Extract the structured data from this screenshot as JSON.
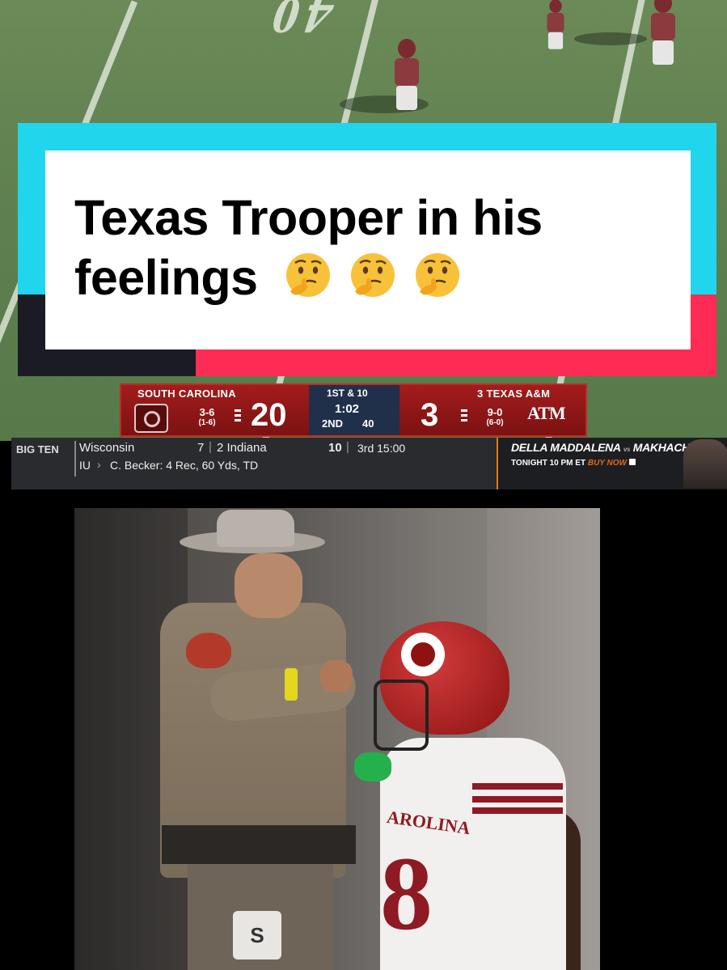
{
  "caption": {
    "line1": "Texas Trooper in his",
    "line2": "feelings",
    "emoji": "🤔🤔🤔",
    "emoji_icons": [
      "thinking-face",
      "thinking-face",
      "thinking-face"
    ]
  },
  "scorebug": {
    "home_team": "SOUTH CAROLINA",
    "home_record": "3-6",
    "home_conf_record": "(1-6)",
    "home_score": "20",
    "down_distance": "1ST & 10",
    "clock": "1:02",
    "quarter": "2ND",
    "yard_line": "40",
    "away_rank_team": "3 TEXAS A&M",
    "away_record": "9-0",
    "away_conf_record": "(6-0)",
    "away_score": "3",
    "away_logo": "ATM",
    "colors": {
      "home": "#a31c1c",
      "middle": "#21304a",
      "away": "#a31c1c"
    }
  },
  "ticker": {
    "conference": "BIG TEN",
    "team1": "Wisconsin",
    "score1": "7",
    "team2": "2 Indiana",
    "score2": "10",
    "period": "3rd 15:00",
    "stat_team": "IU",
    "stat_line": "C. Becker: 4 Rec, 60 Yds, TD",
    "promo_title_a": "DELLA MADDALENA",
    "promo_vs": "vs",
    "promo_title_b": "MAKHACHEV",
    "promo_time": "TONIGHT 10 PM ET",
    "promo_cta": "BUY NOW"
  },
  "clip": {
    "jersey_text": "AROLINA",
    "jersey_number": "8",
    "badge_letter": "S"
  },
  "accent_colors": {
    "cyan": "#20d5ec",
    "red": "#fe2c55"
  }
}
